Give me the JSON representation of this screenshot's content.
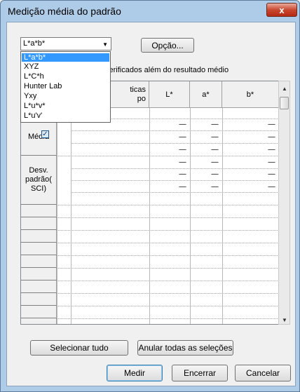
{
  "window": {
    "title": "Medição média do padrão",
    "close_glyph": "x"
  },
  "colorspace": {
    "selected": "L*a*b*",
    "options": [
      "L*a*b*",
      "XYZ",
      "L*C*h",
      "Hunter Lab",
      "Yxy",
      "L*u*v*",
      "L*u'v'"
    ]
  },
  "option_button": "Opção...",
  "caption": "verificados além do resultado médio",
  "table": {
    "headers": [
      "ticas",
      "po",
      "L*",
      "a*",
      "b*"
    ],
    "dash": "-----",
    "rows_labels": {
      "media": "Média",
      "desv": "Desv. padrão( SCI)"
    },
    "media_checked": true
  },
  "buttons": {
    "select_all": "Selecionar tudo",
    "clear_all": "Anular todas as seleções",
    "measure": "Medir",
    "close": "Encerrar",
    "cancel": "Cancelar"
  }
}
